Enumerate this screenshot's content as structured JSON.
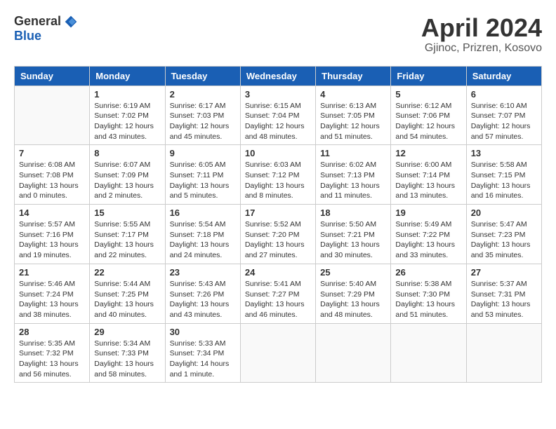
{
  "header": {
    "logo_general": "General",
    "logo_blue": "Blue",
    "month_title": "April 2024",
    "location": "Gjinoc, Prizren, Kosovo"
  },
  "calendar": {
    "days_of_week": [
      "Sunday",
      "Monday",
      "Tuesday",
      "Wednesday",
      "Thursday",
      "Friday",
      "Saturday"
    ],
    "weeks": [
      [
        {
          "day": "",
          "info": ""
        },
        {
          "day": "1",
          "info": "Sunrise: 6:19 AM\nSunset: 7:02 PM\nDaylight: 12 hours\nand 43 minutes."
        },
        {
          "day": "2",
          "info": "Sunrise: 6:17 AM\nSunset: 7:03 PM\nDaylight: 12 hours\nand 45 minutes."
        },
        {
          "day": "3",
          "info": "Sunrise: 6:15 AM\nSunset: 7:04 PM\nDaylight: 12 hours\nand 48 minutes."
        },
        {
          "day": "4",
          "info": "Sunrise: 6:13 AM\nSunset: 7:05 PM\nDaylight: 12 hours\nand 51 minutes."
        },
        {
          "day": "5",
          "info": "Sunrise: 6:12 AM\nSunset: 7:06 PM\nDaylight: 12 hours\nand 54 minutes."
        },
        {
          "day": "6",
          "info": "Sunrise: 6:10 AM\nSunset: 7:07 PM\nDaylight: 12 hours\nand 57 minutes."
        }
      ],
      [
        {
          "day": "7",
          "info": "Sunrise: 6:08 AM\nSunset: 7:08 PM\nDaylight: 13 hours\nand 0 minutes."
        },
        {
          "day": "8",
          "info": "Sunrise: 6:07 AM\nSunset: 7:09 PM\nDaylight: 13 hours\nand 2 minutes."
        },
        {
          "day": "9",
          "info": "Sunrise: 6:05 AM\nSunset: 7:11 PM\nDaylight: 13 hours\nand 5 minutes."
        },
        {
          "day": "10",
          "info": "Sunrise: 6:03 AM\nSunset: 7:12 PM\nDaylight: 13 hours\nand 8 minutes."
        },
        {
          "day": "11",
          "info": "Sunrise: 6:02 AM\nSunset: 7:13 PM\nDaylight: 13 hours\nand 11 minutes."
        },
        {
          "day": "12",
          "info": "Sunrise: 6:00 AM\nSunset: 7:14 PM\nDaylight: 13 hours\nand 13 minutes."
        },
        {
          "day": "13",
          "info": "Sunrise: 5:58 AM\nSunset: 7:15 PM\nDaylight: 13 hours\nand 16 minutes."
        }
      ],
      [
        {
          "day": "14",
          "info": "Sunrise: 5:57 AM\nSunset: 7:16 PM\nDaylight: 13 hours\nand 19 minutes."
        },
        {
          "day": "15",
          "info": "Sunrise: 5:55 AM\nSunset: 7:17 PM\nDaylight: 13 hours\nand 22 minutes."
        },
        {
          "day": "16",
          "info": "Sunrise: 5:54 AM\nSunset: 7:18 PM\nDaylight: 13 hours\nand 24 minutes."
        },
        {
          "day": "17",
          "info": "Sunrise: 5:52 AM\nSunset: 7:20 PM\nDaylight: 13 hours\nand 27 minutes."
        },
        {
          "day": "18",
          "info": "Sunrise: 5:50 AM\nSunset: 7:21 PM\nDaylight: 13 hours\nand 30 minutes."
        },
        {
          "day": "19",
          "info": "Sunrise: 5:49 AM\nSunset: 7:22 PM\nDaylight: 13 hours\nand 33 minutes."
        },
        {
          "day": "20",
          "info": "Sunrise: 5:47 AM\nSunset: 7:23 PM\nDaylight: 13 hours\nand 35 minutes."
        }
      ],
      [
        {
          "day": "21",
          "info": "Sunrise: 5:46 AM\nSunset: 7:24 PM\nDaylight: 13 hours\nand 38 minutes."
        },
        {
          "day": "22",
          "info": "Sunrise: 5:44 AM\nSunset: 7:25 PM\nDaylight: 13 hours\nand 40 minutes."
        },
        {
          "day": "23",
          "info": "Sunrise: 5:43 AM\nSunset: 7:26 PM\nDaylight: 13 hours\nand 43 minutes."
        },
        {
          "day": "24",
          "info": "Sunrise: 5:41 AM\nSunset: 7:27 PM\nDaylight: 13 hours\nand 46 minutes."
        },
        {
          "day": "25",
          "info": "Sunrise: 5:40 AM\nSunset: 7:29 PM\nDaylight: 13 hours\nand 48 minutes."
        },
        {
          "day": "26",
          "info": "Sunrise: 5:38 AM\nSunset: 7:30 PM\nDaylight: 13 hours\nand 51 minutes."
        },
        {
          "day": "27",
          "info": "Sunrise: 5:37 AM\nSunset: 7:31 PM\nDaylight: 13 hours\nand 53 minutes."
        }
      ],
      [
        {
          "day": "28",
          "info": "Sunrise: 5:35 AM\nSunset: 7:32 PM\nDaylight: 13 hours\nand 56 minutes."
        },
        {
          "day": "29",
          "info": "Sunrise: 5:34 AM\nSunset: 7:33 PM\nDaylight: 13 hours\nand 58 minutes."
        },
        {
          "day": "30",
          "info": "Sunrise: 5:33 AM\nSunset: 7:34 PM\nDaylight: 14 hours\nand 1 minute."
        },
        {
          "day": "",
          "info": ""
        },
        {
          "day": "",
          "info": ""
        },
        {
          "day": "",
          "info": ""
        },
        {
          "day": "",
          "info": ""
        }
      ]
    ]
  }
}
